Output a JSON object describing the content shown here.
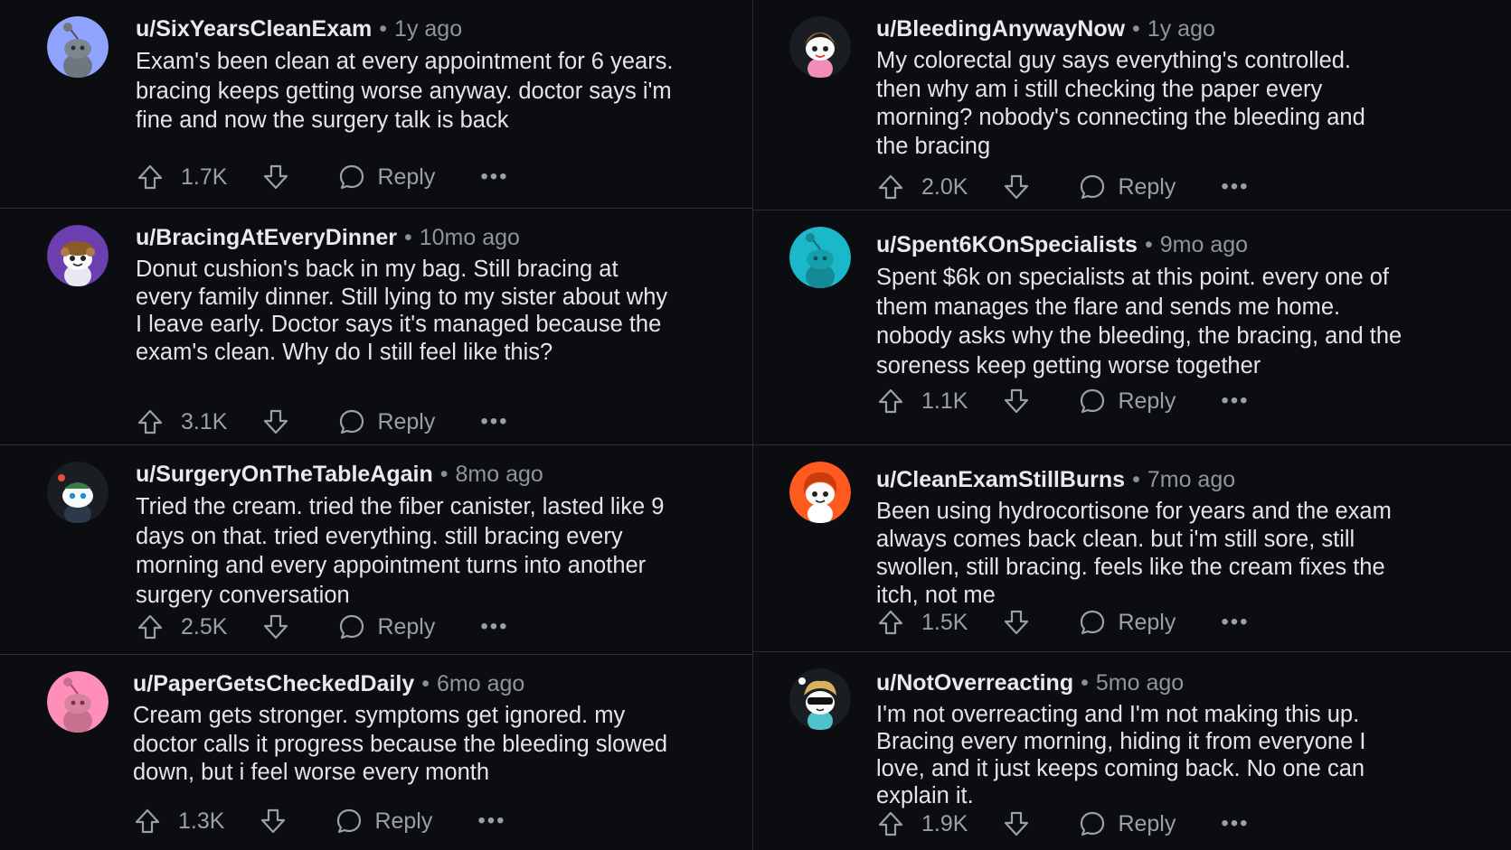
{
  "comments": {
    "left": [
      {
        "user": "u/SixYearsCleanExam",
        "time": "1y ago",
        "avatar_color": "#8fa3ff",
        "avatar_icon": "snoo-avatar-icon",
        "text": "Exam's been clean at every appointment for 6 years. bracing keeps getting worse anyway. doctor says i'm fine and now the surgery talk is back",
        "score": "1.7K",
        "reply": "Reply"
      },
      {
        "user": "u/BracingAtEveryDinner",
        "time": "10mo ago",
        "avatar_color": "#6b3fb0",
        "avatar_icon": "snoo-avatar-icon",
        "text": "Donut cushion's back in my bag. Still bracing at every family dinner. Still lying to my sister about why I leave early. Doctor says it's managed because the exam's clean. Why do I still feel like this?",
        "score": "3.1K",
        "reply": "Reply"
      },
      {
        "user": "u/SurgeryOnTheTableAgain",
        "time": "8mo ago",
        "avatar_color": "#1a1d21",
        "avatar_icon": "snoo-avatar-icon",
        "text": "Tried the cream. tried the fiber canister, lasted like 9 days on that. tried everything. still bracing every morning and every appointment turns into another surgery conversation",
        "score": "2.5K",
        "reply": "Reply"
      },
      {
        "user": "u/PaperGetsCheckedDaily",
        "time": "6mo ago",
        "avatar_color": "#ff8fb8",
        "avatar_icon": "snoo-avatar-icon",
        "text": "Cream gets stronger. symptoms get ignored. my doctor calls it progress because the bleeding slowed down, but i feel worse every month",
        "score": "1.3K",
        "reply": "Reply"
      }
    ],
    "right": [
      {
        "user": "u/BleedingAnywayNow",
        "time": "1y ago",
        "avatar_color": "#1a1d21",
        "avatar_icon": "snoo-avatar-icon",
        "text": "My colorectal guy says everything's controlled. then why am i still checking the paper every morning? nobody's connecting the bleeding and the bracing",
        "score": "2.0K",
        "reply": "Reply"
      },
      {
        "user": "u/Spent6KOnSpecialists",
        "time": "9mo ago",
        "avatar_color": "#1ab8c8",
        "avatar_icon": "snoo-avatar-icon",
        "text": "Spent $6k on specialists at this point. every one of them manages the flare and sends me home. nobody asks why the bleeding, the bracing, and the soreness keep getting worse together",
        "score": "1.1K",
        "reply": "Reply"
      },
      {
        "user": "u/CleanExamStillBurns",
        "time": "7mo ago",
        "avatar_color": "#ff5a1f",
        "avatar_icon": "snoo-avatar-icon",
        "text": "Been using hydrocortisone for years and the exam always comes back clean. but i'm still sore, still swollen, still bracing. feels like the cream fixes the itch, not me",
        "score": "1.5K",
        "reply": "Reply"
      },
      {
        "user": "u/NotOverreacting",
        "time": "5mo ago",
        "avatar_color": "#1a1d21",
        "avatar_icon": "snoo-avatar-icon",
        "text": "I'm not overreacting and I'm not making this up. Bracing every morning, hiding it from everyone I love, and it just keeps coming back. No one can explain it.",
        "score": "1.9K",
        "reply": "Reply"
      }
    ]
  },
  "icons": {
    "upvote": "upvote-arrow-icon",
    "downvote": "downvote-arrow-icon",
    "reply": "speech-bubble-icon",
    "more": "more-options-icon",
    "more_glyph": "•••"
  }
}
